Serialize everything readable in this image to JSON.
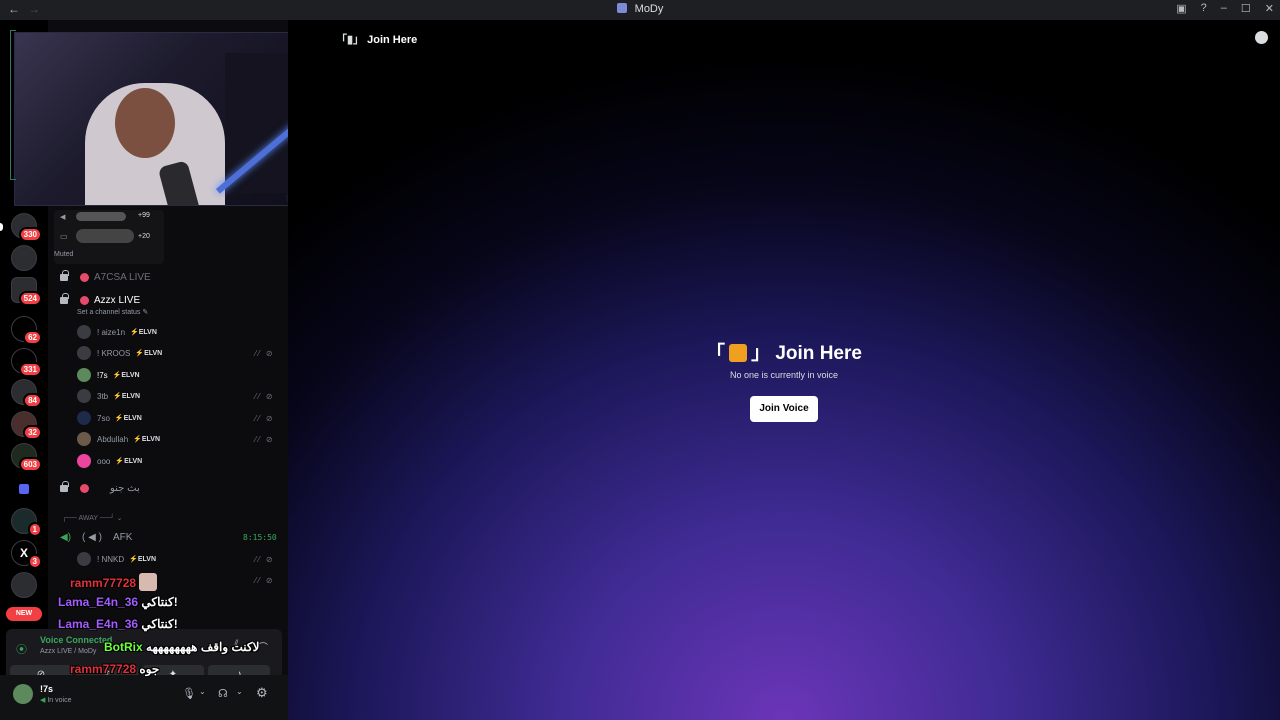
{
  "window": {
    "title": "MoDy"
  },
  "servers": [
    {
      "badge": "330"
    },
    {
      "badge": ""
    },
    {
      "badge": "524"
    },
    {
      "badge": "62"
    },
    {
      "badge": "331"
    },
    {
      "badge": "84"
    },
    {
      "badge": "32"
    },
    {
      "badge": "603"
    },
    {
      "badge": ""
    },
    {
      "badge": "1"
    },
    {
      "badge": "3"
    }
  ],
  "new_label": "NEW",
  "stream": {
    "count1": "+99",
    "count2": "+20",
    "status": "Muted"
  },
  "channels": {
    "a7csa": "A7CSA LIVE",
    "azzx": "Azzx LIVE",
    "status_placeholder": "Set a channel status",
    "members": [
      {
        "name": "! aize1n",
        "tag": "ELVN"
      },
      {
        "name": "! KROOS",
        "tag": "ELVN"
      },
      {
        "name": "!7s",
        "tag": "ELVN"
      },
      {
        "name": "3tb",
        "tag": "ELVN"
      },
      {
        "name": "7so",
        "tag": "ELVN"
      },
      {
        "name": "Abdullah",
        "tag": "ELVN"
      },
      {
        "name": "ooo",
        "tag": "ELVN"
      }
    ],
    "arabic_channel": "بث جنو",
    "category_away": "AWAY",
    "afk": "AFK",
    "afk_timer": "8:15:50",
    "afk_member": {
      "name": "! NNKD",
      "tag": "ELVN"
    }
  },
  "voice_panel": {
    "status": "Voice Connected",
    "location": "Azzx LIVE / MoDy"
  },
  "user": {
    "name": "!7s",
    "status": "In voice"
  },
  "chat_overlay": [
    {
      "user": "ramm77728",
      "msg": "",
      "color": "#e0323c"
    },
    {
      "user": "Lama_E4n_36",
      "msg": "كنتاكي!",
      "color": "#a35cff"
    },
    {
      "user": "Lama_E4n_36",
      "msg": "كنتاكي!",
      "color": "#a35cff"
    },
    {
      "user": "BotRix",
      "msg": "لاكنت واقف ههههههههه",
      "color": "#6cff3c"
    },
    {
      "user": "ramm77728",
      "msg": "جوه",
      "color": "#e0323c"
    }
  ],
  "main": {
    "header": "Join Here",
    "title": "Join Here",
    "subtitle": "No one is currently in voice",
    "join_button": "Join Voice"
  }
}
